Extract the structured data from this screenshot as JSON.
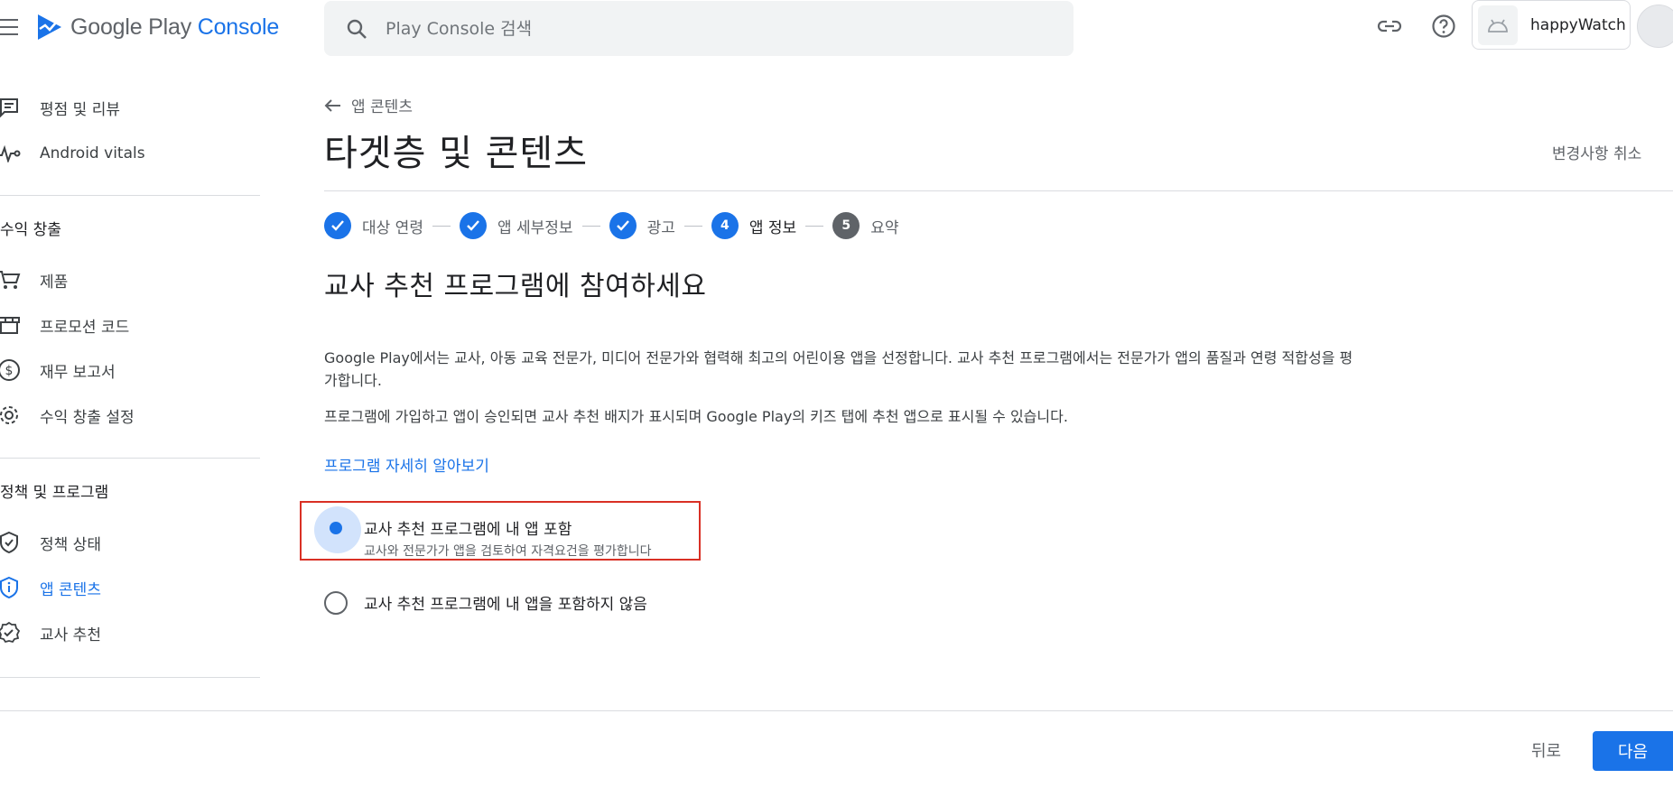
{
  "topbar": {
    "logo_text_main": "Google Play",
    "logo_text_console": "Console",
    "search_placeholder": "Play Console 검색",
    "app_name": "happyWatch"
  },
  "sidebar": {
    "items_top": [
      {
        "label": "평점 및 리뷰",
        "icon": "reviews-icon"
      },
      {
        "label": "Android vitals",
        "icon": "vitals-icon"
      }
    ],
    "section_monetize": "수익 창출",
    "items_monetize": [
      {
        "label": "제품",
        "icon": "cart-icon"
      },
      {
        "label": "프로모션 코드",
        "icon": "store-icon"
      },
      {
        "label": "재무 보고서",
        "icon": "dollar-icon"
      },
      {
        "label": "수익 창출 설정",
        "icon": "gear-icon"
      }
    ],
    "section_policy": "정책 및 프로그램",
    "items_policy": [
      {
        "label": "정책 상태",
        "icon": "shield-check-icon"
      },
      {
        "label": "앱 콘텐츠",
        "icon": "shield-info-icon",
        "active": true
      },
      {
        "label": "교사 추천",
        "icon": "badge-icon"
      }
    ]
  },
  "main": {
    "breadcrumb": "앱 콘텐츠",
    "title": "타겟층 및 콘텐츠",
    "cancel": "변경사항 취소",
    "steps": [
      {
        "label": "대상 연령",
        "state": "done"
      },
      {
        "label": "앱 세부정보",
        "state": "done"
      },
      {
        "label": "광고",
        "state": "done"
      },
      {
        "label": "앱 정보",
        "state": "current",
        "num": "4"
      },
      {
        "label": "요약",
        "state": "pending",
        "num": "5"
      }
    ],
    "section_title": "교사 추천 프로그램에 참여하세요",
    "para1": "Google Play에서는 교사, 아동 교육 전문가, 미디어 전문가와 협력해 최고의 어린이용 앱을 선정합니다. 교사 추천 프로그램에서는 전문가가 앱의 품질과 연령 적합성을 평가합니다.",
    "para2": "프로그램에 가입하고 앱이 승인되면 교사 추천 배지가 표시되며 Google Play의 키즈 탭에 추천 앱으로 표시될 수 있습니다.",
    "learn_more": "프로그램 자세히 알아보기",
    "option_include": {
      "label": "교사 추천 프로그램에 내 앱 포함",
      "sub": "교사와 전문가가 앱을 검토하여 자격요건을 평가합니다",
      "selected": true
    },
    "option_exclude": {
      "label": "교사 추천 프로그램에 내 앱을 포함하지 않음",
      "selected": false
    }
  },
  "footer": {
    "back": "뒤로",
    "next": "다음"
  },
  "colors": {
    "accent": "#1a73e8",
    "highlight": "#d93025"
  }
}
